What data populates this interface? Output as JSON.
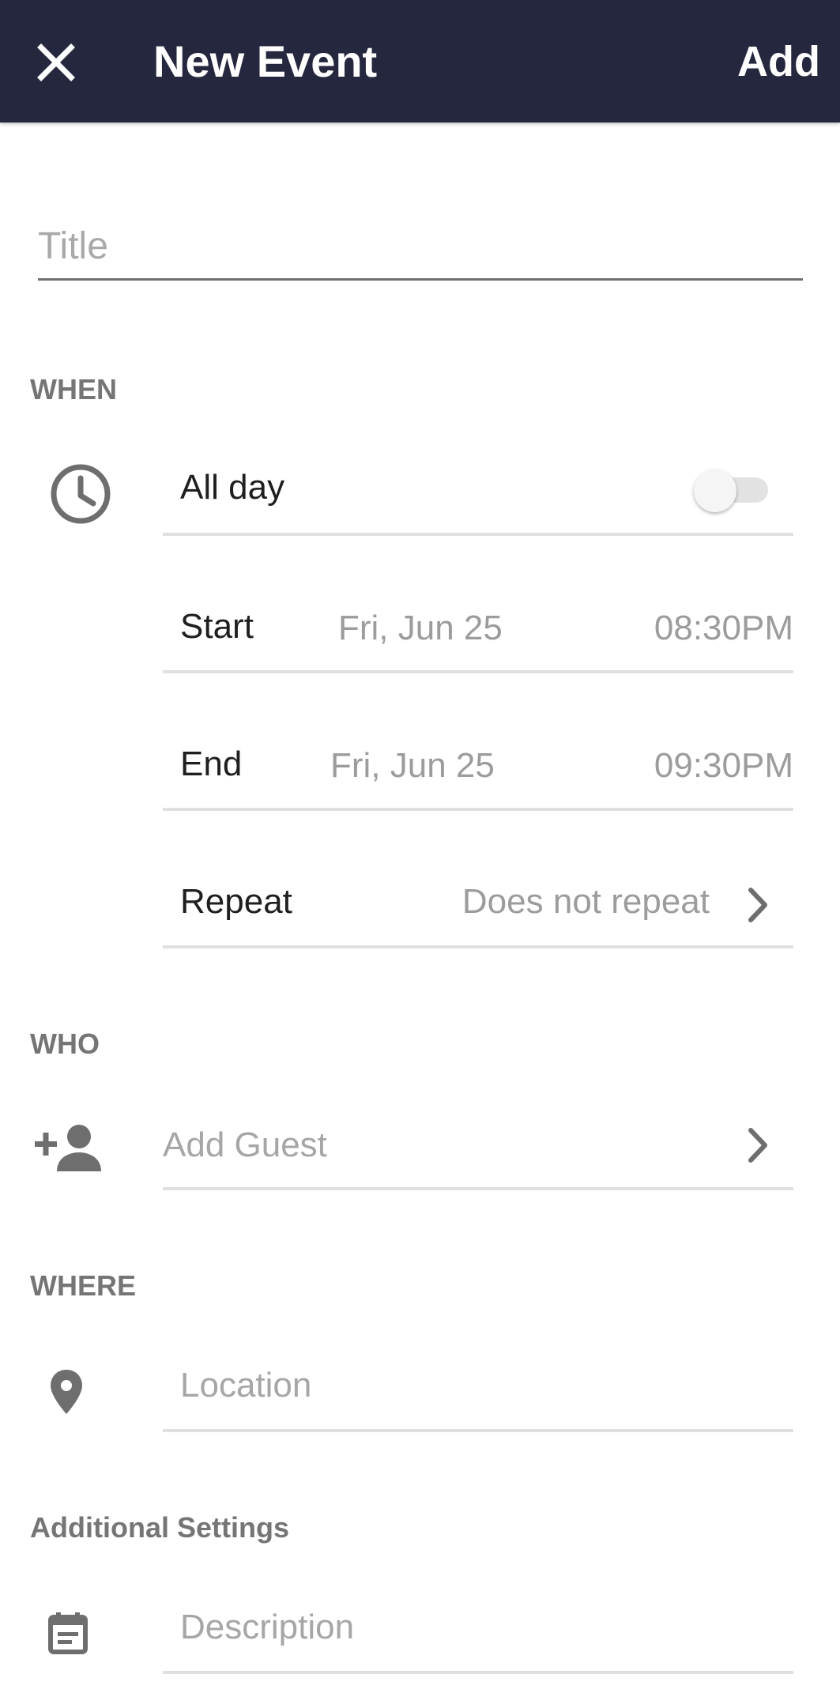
{
  "header": {
    "title": "New Event",
    "add_label": "Add",
    "background_color": "#25273e"
  },
  "title_field": {
    "placeholder": "Title",
    "value": ""
  },
  "when": {
    "section_label": "WHEN",
    "all_day": {
      "label": "All day",
      "enabled": false
    },
    "start": {
      "label": "Start",
      "date": "Fri, Jun 25",
      "time": "08:30PM"
    },
    "end": {
      "label": "End",
      "date": "Fri, Jun 25",
      "time": "09:30PM"
    },
    "repeat": {
      "label": "Repeat",
      "value": "Does not repeat"
    }
  },
  "who": {
    "section_label": "WHO",
    "add_guest_placeholder": "Add Guest"
  },
  "where": {
    "section_label": "WHERE",
    "location_placeholder": "Location"
  },
  "additional": {
    "section_label": "Additional Settings",
    "description_placeholder": "Description"
  },
  "icons": [
    "close-icon",
    "clock-icon",
    "chevron-right-icon",
    "add-person-icon",
    "location-pin-icon",
    "event-note-icon"
  ]
}
